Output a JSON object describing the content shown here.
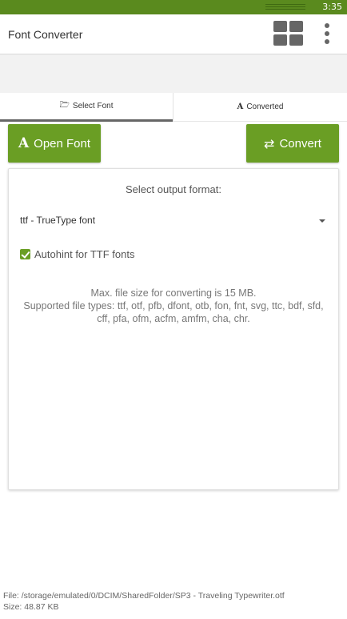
{
  "status_bar": {
    "time": "3:35"
  },
  "app_bar": {
    "title": "Font Converter",
    "grid_icon": "grid-view-icon",
    "more_icon": "more-vert-icon"
  },
  "tabs": [
    {
      "label": "Select Font",
      "icon": "folder-open-icon",
      "glyph": "🗁",
      "active": true
    },
    {
      "label": "Converted",
      "icon": "font-icon",
      "glyph": "A",
      "active": false
    }
  ],
  "buttons": {
    "open_font": {
      "label": "Open Font",
      "glyph": "A",
      "icon": "font-icon"
    },
    "convert": {
      "label": "Convert",
      "glyph": "⇄",
      "icon": "exchange-icon"
    }
  },
  "card": {
    "heading": "Select output format:",
    "format_select": {
      "value": "ttf - TrueType font"
    },
    "autohint": {
      "label": "Autohint for TTF fonts",
      "checked": true
    },
    "info_line1": "Max. file size for converting is 15 MB.",
    "info_line2": "Supported file types: ttf, otf, pfb, dfont, otb, fon, fnt, svg, ttc, bdf, sfd, cff, pfa, ofm, acfm, amfm, cha, chr."
  },
  "footer": {
    "file": "File: /storage/emulated/0/DCIM/SharedFolder/SP3 - Traveling Typewriter.otf",
    "size": "Size: 48.87 KB"
  },
  "colors": {
    "accent": "#6a9e24",
    "status_bar": "#5a8a1e"
  }
}
